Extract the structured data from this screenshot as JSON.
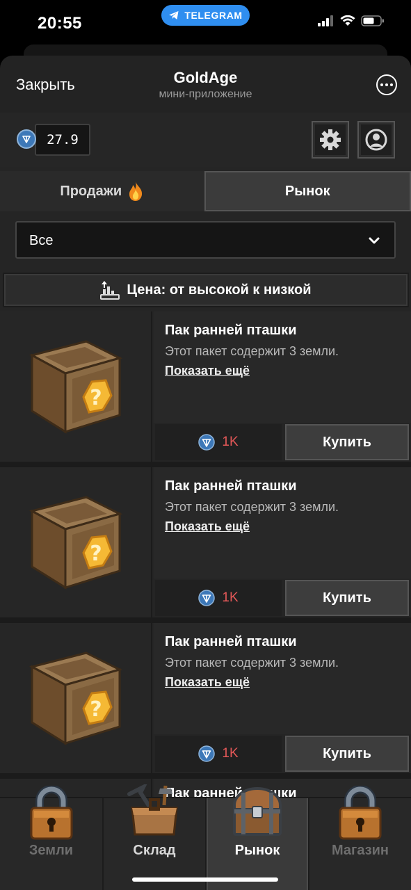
{
  "status_bar": {
    "time": "20:55",
    "telegram_pill": "TELEGRAM"
  },
  "header": {
    "close_label": "Закрыть",
    "title": "GoldAge",
    "subtitle": "мини-приложение"
  },
  "balance": {
    "value": "27.9",
    "currency_icon": "ton-coin-icon"
  },
  "tabs": [
    {
      "label": "Продажи",
      "icon": "fire-icon",
      "active": false
    },
    {
      "label": "Рынок",
      "active": true
    }
  ],
  "filter": {
    "selected": "Все"
  },
  "sort": {
    "label": "Цена: от высокой к низкой"
  },
  "listings": [
    {
      "name": "Пак ранней пташки",
      "description": "Этот пакет содержит 3 земли.",
      "more_label": "Показать ещё",
      "price": "1K",
      "buy_label": "Купить"
    },
    {
      "name": "Пак ранней пташки",
      "description": "Этот пакет содержит 3 земли.",
      "more_label": "Показать ещё",
      "price": "1K",
      "buy_label": "Купить"
    },
    {
      "name": "Пак ранней пташки",
      "description": "Этот пакет содержит 3 земли.",
      "more_label": "Показать ещё",
      "price": "1K",
      "buy_label": "Купить"
    },
    {
      "name": "Пак ранней пташки"
    }
  ],
  "bottom_nav": [
    {
      "label": "Земли",
      "icon": "padlock-icon",
      "state": "locked"
    },
    {
      "label": "Склад",
      "icon": "toolbox-icon",
      "state": "normal"
    },
    {
      "label": "Рынок",
      "icon": "chest-icon",
      "state": "active"
    },
    {
      "label": "Магазин",
      "icon": "padlock-icon",
      "state": "locked"
    }
  ],
  "colors": {
    "accent_blue": "#2f8ef0",
    "price_red": "#e45858",
    "background": "#252525"
  }
}
